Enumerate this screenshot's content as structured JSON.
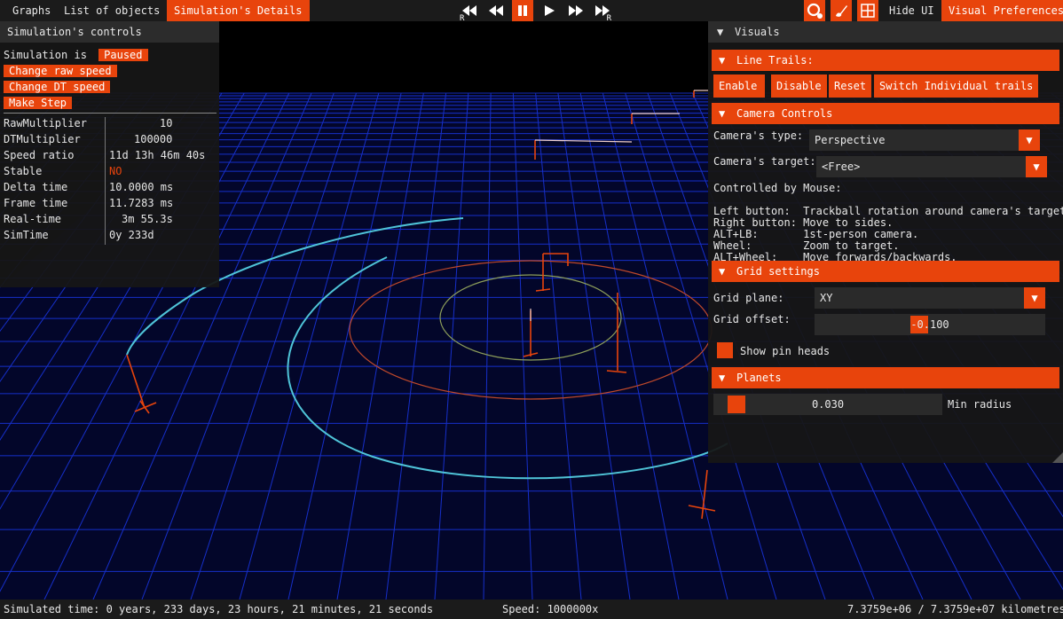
{
  "menubar": {
    "items": [
      "Graphs",
      "List of objects",
      "Simulation's Details"
    ],
    "active_item": "Simulation's Details",
    "right_items": {
      "hide_ui": "Hide UI",
      "visual_prefs": "Visual Preferences"
    },
    "playback": {
      "rewind_reset": {
        "icon": "rewind-reset-icon",
        "sub": "R"
      },
      "rewind": {
        "icon": "rewind-icon"
      },
      "pause": {
        "icon": "pause-icon",
        "active": true
      },
      "play": {
        "icon": "play-icon"
      },
      "fast_forward": {
        "icon": "fast-forward-icon"
      },
      "fast_forward_reset": {
        "icon": "fast-forward-reset-icon",
        "sub": "R"
      }
    },
    "tools": [
      "search-settings-icon",
      "brush-icon",
      "grid-icon"
    ]
  },
  "sim_controls": {
    "title": "Simulation's controls",
    "status_label": "Simulation is",
    "status_value": "Paused",
    "buttons": [
      "Change raw speed",
      "Change DT speed",
      "Make Step"
    ],
    "table": [
      {
        "key": "RawMultiplier",
        "value": "10"
      },
      {
        "key": "DTMultiplier",
        "value": "100000"
      },
      {
        "key": "Speed ratio",
        "value": "11d 13h 46m 40s"
      },
      {
        "key": "Stable",
        "value": "NO"
      },
      {
        "key": "Delta time",
        "value": "10.0000 ms"
      },
      {
        "key": "Frame time",
        "value": "11.7283 ms"
      },
      {
        "key": "Real-time",
        "value": "3m 55.3s"
      },
      {
        "key": "SimTime",
        "value": "0y 233d"
      }
    ],
    "colors": {
      "stable_no": "#e8440c"
    }
  },
  "visuals": {
    "title": "Visuals",
    "line_trails": {
      "title": "Line Trails:",
      "buttons": [
        "Enable",
        "Disable",
        "Reset",
        "Switch Individual trails"
      ]
    },
    "camera": {
      "title": "Camera Controls",
      "type_label": "Camera's type:",
      "type_value": "Perspective",
      "target_label": "Camera's target:",
      "target_value": "<Free>",
      "help": "Controlled by Mouse:\n\nLeft button:  Trackball rotation around camera's target.\nRight button: Move to sides.\nALT+LB:       1st-person camera.\nWheel:        Zoom to target.\nALT+Wheel:    Move forwards/backwards."
    },
    "grid": {
      "title": "Grid settings",
      "plane_label": "Grid plane:",
      "plane_value": "XY",
      "offset_label": "Grid offset:",
      "offset_value": "-0.100",
      "pin_heads_label": "Show pin heads"
    },
    "planets": {
      "title": "Planets",
      "min_radius_value": "0.030",
      "min_radius_label": "Min radius"
    }
  },
  "statusbar": {
    "simulated_time": "Simulated time: 0 years, 233 days, 23 hours, 21 minutes, 21 seconds",
    "speed": "Speed: 1000000x",
    "scale": "7.3759e+06 / 7.3759e+07 kilometres"
  },
  "colors": {
    "accent": "#e8440c",
    "grid": "#1a3cff",
    "panel": "#161616",
    "trail_cyan": "#4fc4d8"
  }
}
